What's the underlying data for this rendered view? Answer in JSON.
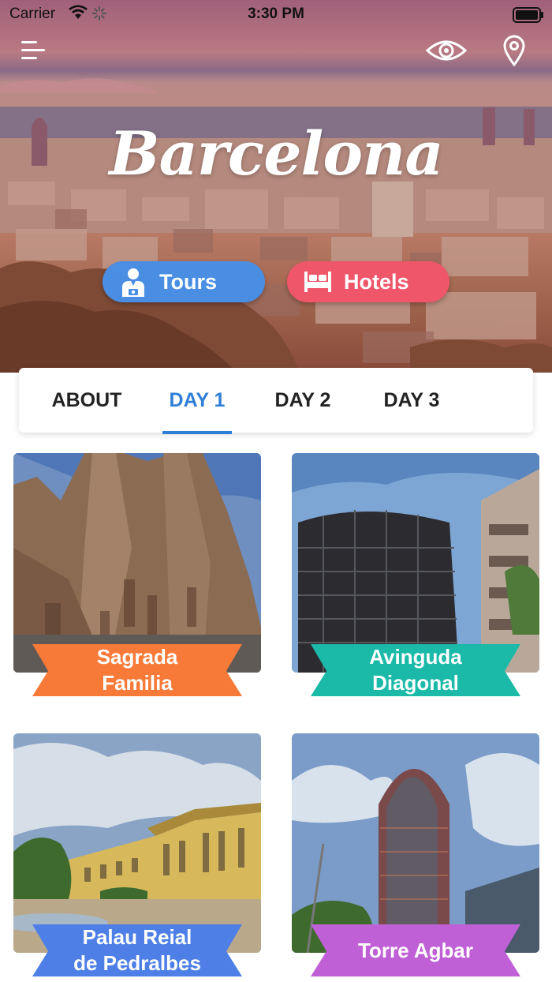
{
  "status_bar": {
    "carrier": "Carrier",
    "time": "3:30 PM"
  },
  "header": {
    "title": "Barcelona",
    "icons": [
      "menu-icon",
      "eye-icon",
      "location-pin-icon"
    ]
  },
  "actions": {
    "tours_label": "Tours",
    "hotels_label": "Hotels",
    "tours_color": "#4a8ee4",
    "hotels_color": "#f0566a"
  },
  "tabs": {
    "items": [
      "ABOUT",
      "DAY 1",
      "DAY 2",
      "DAY 3"
    ],
    "active": "DAY 1",
    "accent": "#2f7fd8"
  },
  "places": [
    {
      "line1": "Sagrada",
      "line2": "Familia",
      "color": "#f77a38"
    },
    {
      "line1": "Avinguda",
      "line2": "Diagonal",
      "color": "#1ab9a8"
    },
    {
      "line1": "Palau Reial",
      "line2": "de Pedralbes",
      "color": "#4d7fe6"
    },
    {
      "line1": "Torre Agbar",
      "line2": "",
      "color": "#c060d6"
    }
  ]
}
